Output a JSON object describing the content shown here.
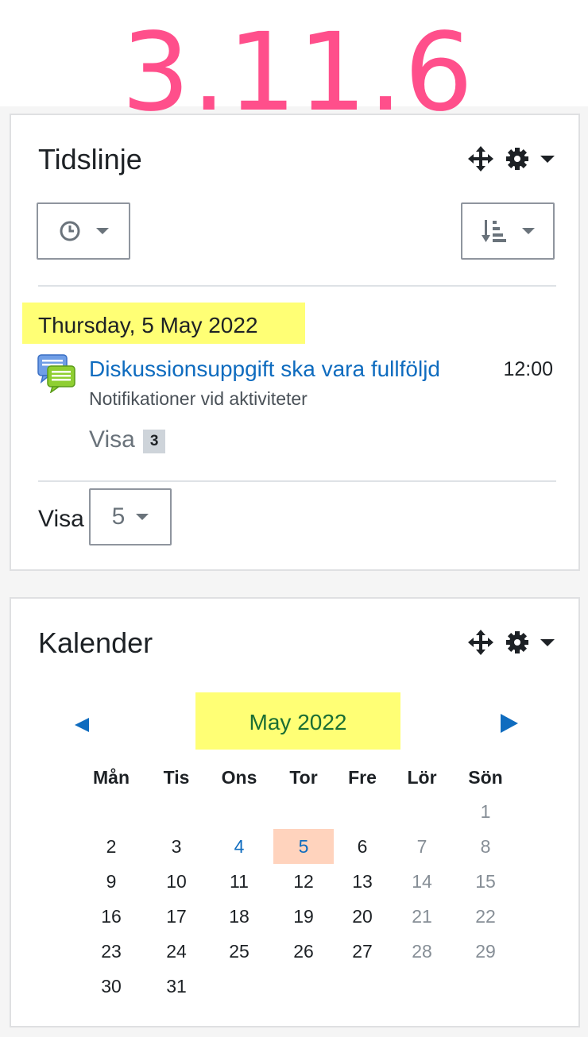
{
  "version_label": "3.11.6",
  "timeline": {
    "title": "Tidslinje",
    "date_heading": "Thursday, 5 May 2022",
    "event": {
      "name": "Diskussionsuppgift ska vara fullföljd",
      "time": "12:00",
      "subtitle": "Notifikationer vid aktiviteter"
    },
    "show_more_label": "Visa",
    "show_more_count": "3",
    "per_page_label": "Visa",
    "per_page_value": "5"
  },
  "calendar": {
    "title": "Kalender",
    "month": "May 2022",
    "weekdays": [
      "Mån",
      "Tis",
      "Ons",
      "Tor",
      "Fre",
      "Lör",
      "Sön"
    ],
    "weeks": [
      [
        "",
        "",
        "",
        "",
        "",
        "",
        "1"
      ],
      [
        "2",
        "3",
        "4",
        "5",
        "6",
        "7",
        "8"
      ],
      [
        "9",
        "10",
        "11",
        "12",
        "13",
        "14",
        "15"
      ],
      [
        "16",
        "17",
        "18",
        "19",
        "20",
        "21",
        "22"
      ],
      [
        "23",
        "24",
        "25",
        "26",
        "27",
        "28",
        "29"
      ],
      [
        "30",
        "31",
        "",
        "",
        "",
        "",
        ""
      ]
    ],
    "event_days": [
      "4",
      "5"
    ],
    "today": "5"
  },
  "colors": {
    "version": "#ff4f8b",
    "link": "#0f6cbf",
    "highlight": "#ffff75",
    "today_bg": "#ffd3bd",
    "month_text": "#1a6e34"
  }
}
